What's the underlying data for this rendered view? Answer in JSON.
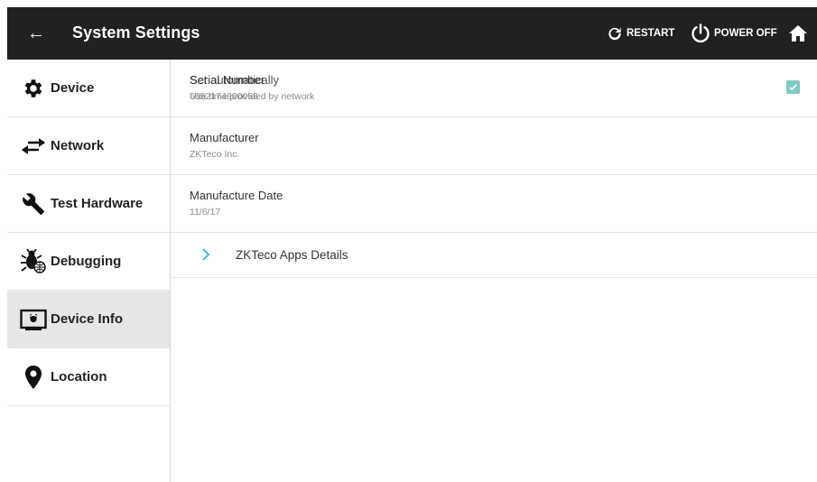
{
  "appbar": {
    "back_icon": "arrow-back-icon",
    "title": "System Settings",
    "restart_label": "RESTART",
    "power_off_label": "POWER OFF",
    "home_icon": "home-icon"
  },
  "sidebar": {
    "items": [
      {
        "label": "Device",
        "icon": "gear-icon"
      },
      {
        "label": "Network",
        "icon": "swap-arrows-icon"
      },
      {
        "label": "Test Hardware",
        "icon": "wrench-icon"
      },
      {
        "label": "Debugging",
        "icon": "bug-icon"
      },
      {
        "label": "Device Info",
        "icon": "device-screen-icon",
        "active": true
      },
      {
        "label": "Location",
        "icon": "location-pin-icon"
      }
    ]
  },
  "main": {
    "rows": [
      {
        "title_a": "Serial Number",
        "title_b": "Set automatically",
        "summary_a": "6052174800056",
        "summary_b": "Use time provided by network",
        "checked": true
      },
      {
        "title": "Manufacturer",
        "summary": "ZKTeco Inc."
      },
      {
        "title": "Manufacture Date",
        "summary": "11/6/17"
      }
    ],
    "details_label": "ZKTeco Apps Details"
  },
  "colors": {
    "appbar": "#212121",
    "active_item": "#e6e6e6",
    "checkbox": "#80cbc4",
    "chevron": "#29b6f6"
  }
}
